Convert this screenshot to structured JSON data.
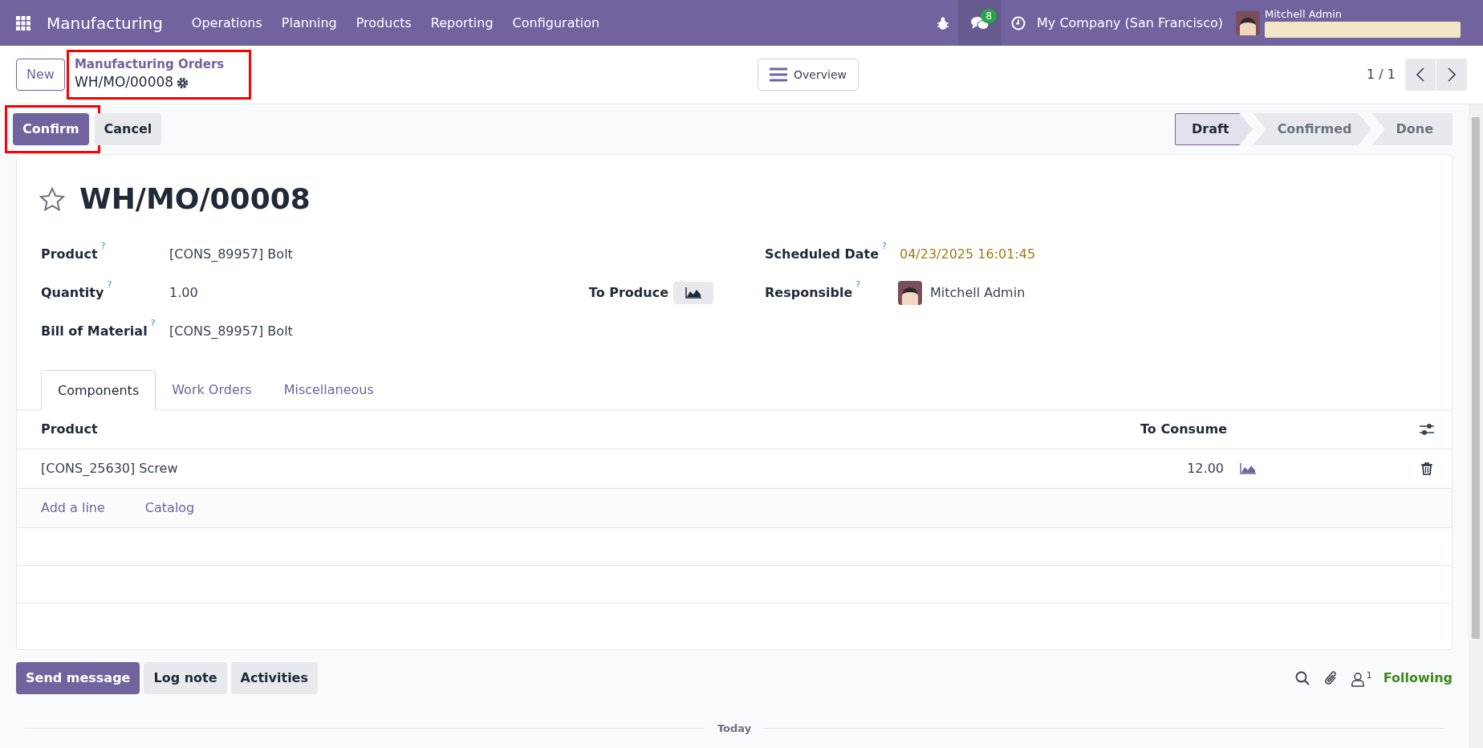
{
  "navbar": {
    "app": "Manufacturing",
    "menus": [
      "Operations",
      "Planning",
      "Products",
      "Reporting",
      "Configuration"
    ],
    "messages_count": "8",
    "company": "My Company (San Francisco)",
    "user": "Mitchell Admin"
  },
  "control_panel": {
    "new_button": "New",
    "breadcrumb": {
      "parent": "Manufacturing Orders",
      "current": "WH/MO/00008",
      "highlighted": true
    },
    "overview_button": "Overview",
    "pager": "1 / 1"
  },
  "actions": [
    {
      "label": "Confirm",
      "kind": "primary",
      "highlighted": true
    },
    {
      "label": "Cancel",
      "kind": "secondary",
      "highlighted": false
    }
  ],
  "status_bar": [
    {
      "label": "Draft",
      "selected": true
    },
    {
      "label": "Confirmed",
      "selected": false
    },
    {
      "label": "Done",
      "selected": false
    }
  ],
  "record": {
    "title": "WH/MO/00008",
    "starred": false,
    "left_fields": [
      {
        "label": "Product",
        "help": "?",
        "value": "[CONS_89957] Bolt"
      },
      {
        "label": "Quantity",
        "help": "?",
        "value": "1.00",
        "extra_label": "To Produce"
      },
      {
        "label": "Bill of Material",
        "help": "?",
        "value": "[CONS_89957] Bolt"
      }
    ],
    "right_fields": [
      {
        "label": "Scheduled Date",
        "help": "?",
        "value": "04/23/2025 16:01:45",
        "kind": "date"
      },
      {
        "label": "Responsible",
        "help": "?",
        "value": "Mitchell Admin",
        "kind": "user"
      }
    ]
  },
  "tabs": [
    {
      "label": "Components",
      "selected": true
    },
    {
      "label": "Work Orders",
      "selected": false
    },
    {
      "label": "Miscellaneous",
      "selected": false
    }
  ],
  "table": {
    "columns": [
      "Product",
      "To Consume"
    ],
    "rows": [
      {
        "product": "[CONS_25630] Screw",
        "to_consume": "12.00"
      }
    ],
    "add_links": [
      "Add a line",
      "Catalog"
    ]
  },
  "chatter": {
    "buttons": [
      {
        "label": "Send message",
        "kind": "primary"
      },
      {
        "label": "Log note",
        "kind": "secondary"
      },
      {
        "label": "Activities",
        "kind": "secondary"
      }
    ],
    "followers_count": "1",
    "following": "Following",
    "separator": "Today"
  }
}
